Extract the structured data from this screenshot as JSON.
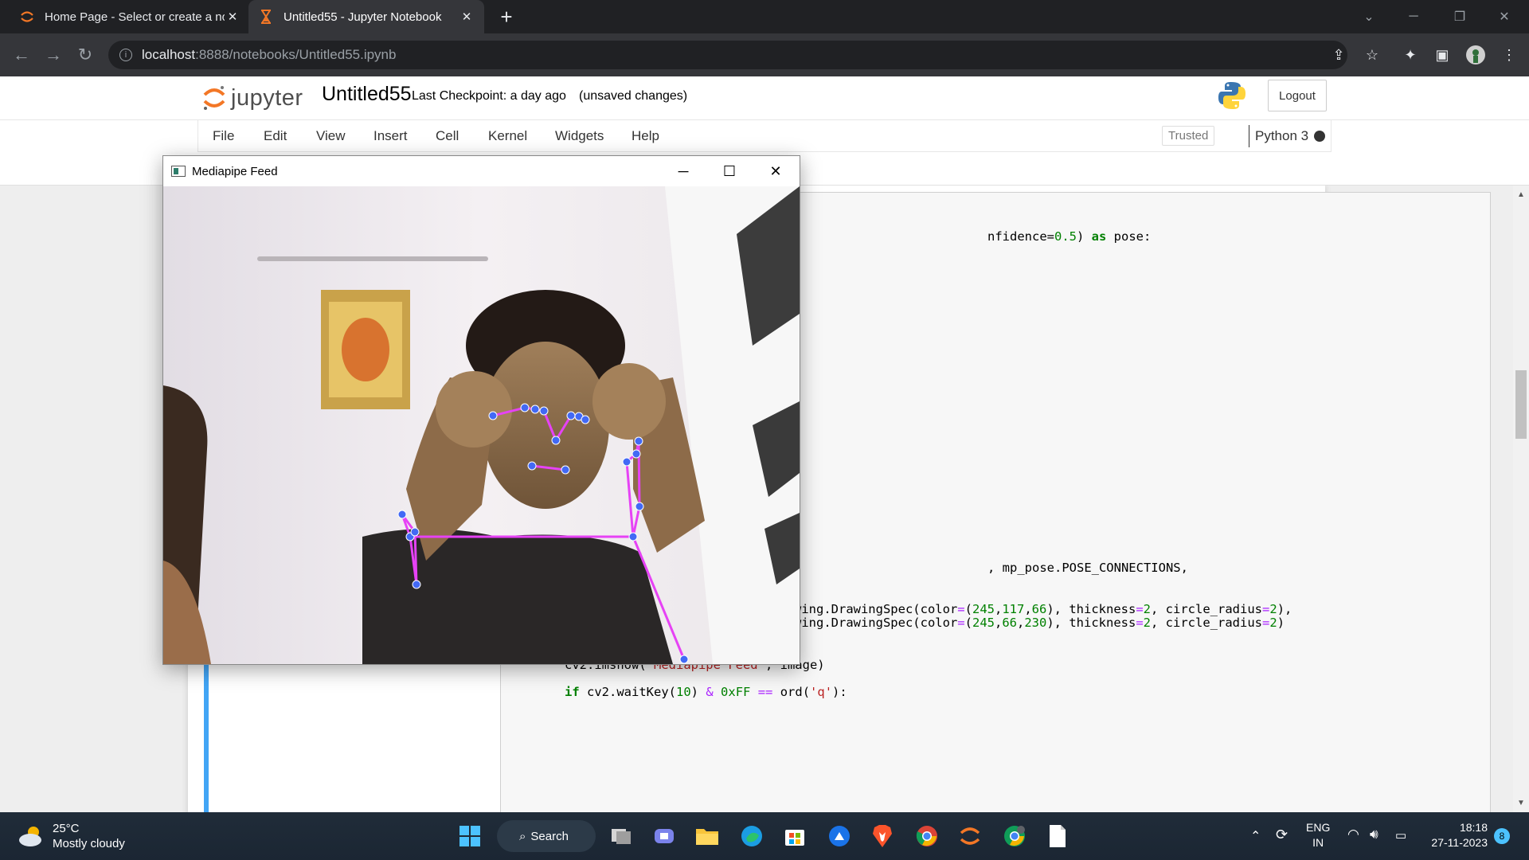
{
  "browser": {
    "tabs": [
      {
        "title": "Home Page - Select or create a notebook",
        "active": false,
        "icon": "jupyter-icon"
      },
      {
        "title": "Untitled55 - Jupyter Notebook",
        "active": true,
        "icon": "hourglass-icon"
      }
    ],
    "url_host": "localhost",
    "url_rest": ":8888/notebooks/Untitled55.ipynb"
  },
  "jupyter": {
    "logo_text": "jupyter",
    "notebook_name": "Untitled55",
    "checkpoint": "Last Checkpoint: a day ago",
    "unsaved": "(unsaved changes)",
    "logout": "Logout",
    "menu": [
      "File",
      "Edit",
      "View",
      "Insert",
      "Cell",
      "Kernel",
      "Widgets",
      "Help"
    ],
    "trusted": "Trusted",
    "kernel": "Python 3"
  },
  "code": {
    "line1_tail": "nfidence=0.5) as pose:",
    "line2_tail": ", mp_pose.POSE_CONNECTIONS,",
    "line3": "mp_drawing.DrawingSpec(color=(245,117,66), thickness=2, circle_radius=2),",
    "line4": "mp_drawing.DrawingSpec(color=(245,66,230), thickness=2, circle_radius=2)",
    "line5": " )",
    "line6": "cv2.imshow('Mediapipe Feed', image)",
    "line7": "if cv2.waitKey(10) & 0xFF == ord('q'):"
  },
  "mp_window": {
    "title": "Mediapipe Feed",
    "landmark_color": "#4269f5",
    "connection_color": "#e642f5"
  },
  "taskbar": {
    "temperature": "25°C",
    "weather": "Mostly cloudy",
    "search": "Search",
    "lang1": "ENG",
    "lang2": "IN",
    "time": "18:18",
    "date": "27-11-2023",
    "notifications": "8"
  }
}
